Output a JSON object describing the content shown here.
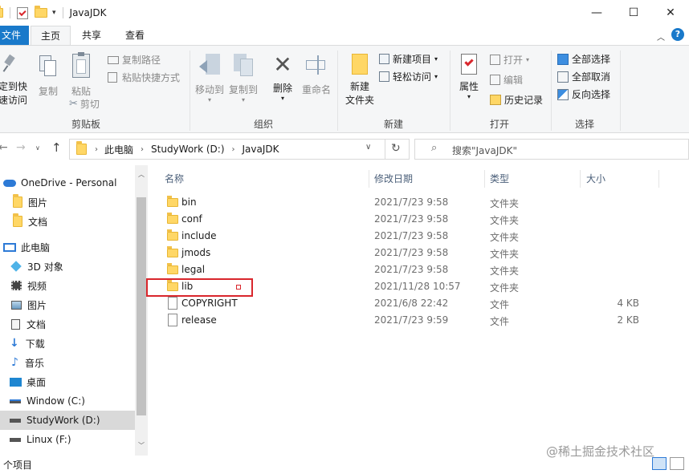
{
  "window": {
    "title": "JavaJDK",
    "minimize_glyph": "—",
    "maximize_glyph": "☐",
    "close_glyph": "✕"
  },
  "ribbon_tabs": {
    "file": "文件",
    "home": "主页",
    "share": "共享",
    "view": "查看"
  },
  "ribbon": {
    "clipboard": {
      "pin_label_1": "定到快",
      "pin_label_2": "速访问",
      "copy": "复制",
      "paste": "粘贴",
      "copy_path": "复制路径",
      "paste_shortcut": "粘贴快捷方式",
      "cut": "剪切",
      "group": "剪贴板"
    },
    "organize": {
      "move_to": "移动到",
      "copy_to": "复制到",
      "delete": "删除",
      "rename": "重命名",
      "group": "组织"
    },
    "new": {
      "new_folder_1": "新建",
      "new_folder_2": "文件夹",
      "new_item": "新建项目",
      "easy_access": "轻松访问",
      "group": "新建"
    },
    "open": {
      "properties": "属性",
      "open": "打开",
      "edit": "编辑",
      "history": "历史记录",
      "group": "打开"
    },
    "select": {
      "select_all": "全部选择",
      "select_none": "全部取消",
      "invert": "反向选择",
      "group": "选择"
    }
  },
  "address": {
    "crumbs": [
      "此电脑",
      "StudyWork (D:)",
      "JavaJDK"
    ],
    "search_placeholder": "搜索\"JavaJDK\""
  },
  "nav": [
    {
      "label": "OneDrive - Personal",
      "icon": "cloud-icon"
    },
    {
      "label": "图片",
      "icon": "folder-icon"
    },
    {
      "label": "文档",
      "icon": "folder-icon"
    },
    {
      "label": "此电脑",
      "icon": "computer-icon"
    },
    {
      "label": "3D 对象",
      "icon": "cube-icon"
    },
    {
      "label": "视频",
      "icon": "video-icon"
    },
    {
      "label": "图片",
      "icon": "pictures-icon"
    },
    {
      "label": "文档",
      "icon": "documents-icon"
    },
    {
      "label": "下载",
      "icon": "download-icon"
    },
    {
      "label": "音乐",
      "icon": "music-icon"
    },
    {
      "label": "桌面",
      "icon": "desktop-icon"
    },
    {
      "label": "Window (C:)",
      "icon": "drive-icon"
    },
    {
      "label": "StudyWork (D:)",
      "icon": "drive-icon",
      "selected": true
    },
    {
      "label": "Linux (F:)",
      "icon": "drive-icon"
    }
  ],
  "columns": {
    "name": "名称",
    "date": "修改日期",
    "type": "类型",
    "size": "大小"
  },
  "files": [
    {
      "name": "bin",
      "date": "2021/7/23 9:58",
      "type": "文件夹",
      "size": "",
      "kind": "folder"
    },
    {
      "name": "conf",
      "date": "2021/7/23 9:58",
      "type": "文件夹",
      "size": "",
      "kind": "folder"
    },
    {
      "name": "include",
      "date": "2021/7/23 9:58",
      "type": "文件夹",
      "size": "",
      "kind": "folder"
    },
    {
      "name": "jmods",
      "date": "2021/7/23 9:58",
      "type": "文件夹",
      "size": "",
      "kind": "folder"
    },
    {
      "name": "legal",
      "date": "2021/7/23 9:58",
      "type": "文件夹",
      "size": "",
      "kind": "folder"
    },
    {
      "name": "lib",
      "date": "2021/11/28 10:57",
      "type": "文件夹",
      "size": "",
      "kind": "folder",
      "highlighted": true
    },
    {
      "name": "COPYRIGHT",
      "date": "2021/6/8 22:42",
      "type": "文件",
      "size": "4 KB",
      "kind": "file"
    },
    {
      "name": "release",
      "date": "2021/7/23 9:59",
      "type": "文件",
      "size": "2 KB",
      "kind": "file"
    }
  ],
  "status": {
    "count": "个项目"
  },
  "watermark": "@稀土掘金技术社区",
  "colors": {
    "accent": "#1979ca",
    "highlight_box": "#d9262c"
  }
}
